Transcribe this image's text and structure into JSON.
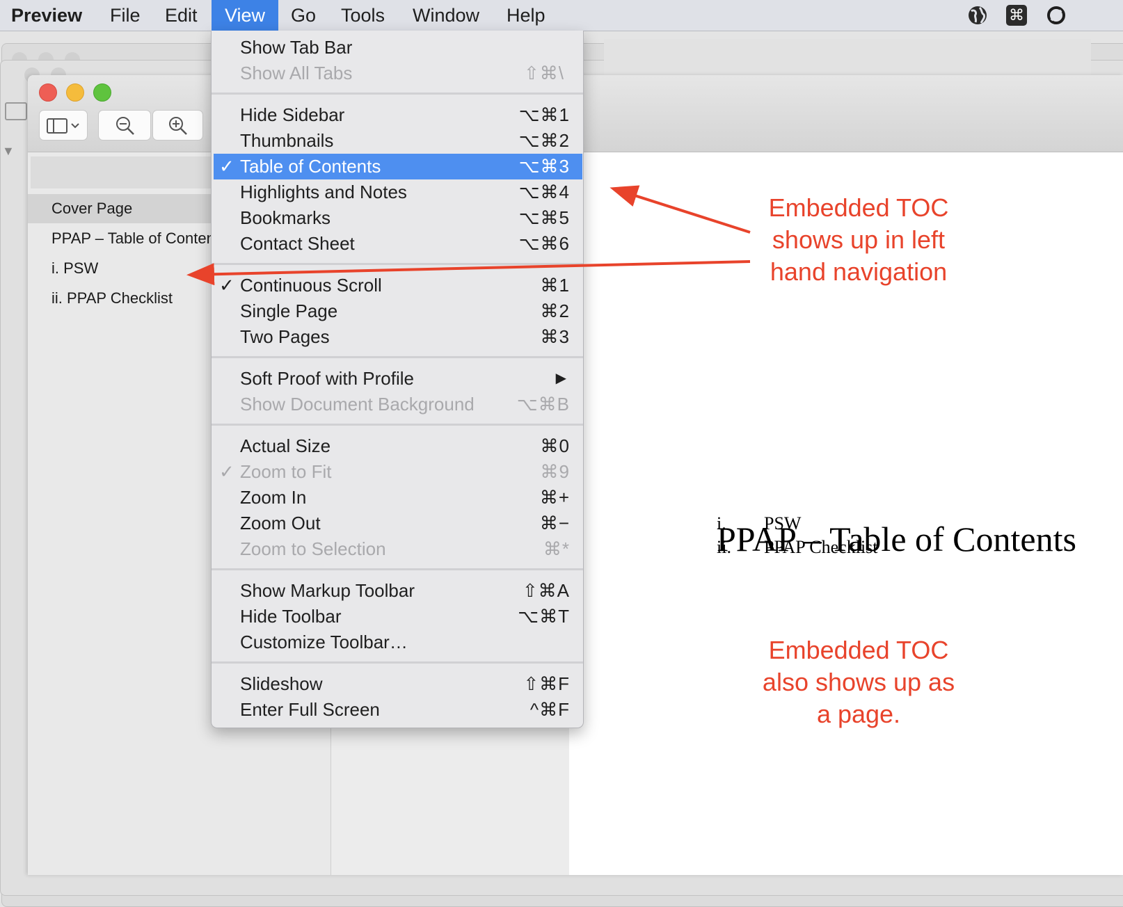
{
  "menubar": {
    "app": "Preview",
    "items": [
      "File",
      "Edit",
      "View",
      "Go",
      "Tools",
      "Window",
      "Help"
    ],
    "active": "View"
  },
  "sidebar": {
    "items": [
      "Cover Page",
      "PPAP – Table of Contents",
      "i. PSW",
      "ii. PPAP Checklist"
    ],
    "selected": "Cover Page"
  },
  "menu": {
    "show_tab_bar": {
      "label": "Show Tab Bar",
      "shortcut": ""
    },
    "show_all_tabs": {
      "label": "Show All Tabs",
      "shortcut": "⇧⌘\\"
    },
    "hide_sidebar": {
      "label": "Hide Sidebar",
      "shortcut": "⌥⌘1"
    },
    "thumbnails": {
      "label": "Thumbnails",
      "shortcut": "⌥⌘2"
    },
    "table_of_contents": {
      "label": "Table of Contents",
      "shortcut": "⌥⌘3"
    },
    "highlights_notes": {
      "label": "Highlights and Notes",
      "shortcut": "⌥⌘4"
    },
    "bookmarks": {
      "label": "Bookmarks",
      "shortcut": "⌥⌘5"
    },
    "contact_sheet": {
      "label": "Contact Sheet",
      "shortcut": "⌥⌘6"
    },
    "continuous_scroll": {
      "label": "Continuous Scroll",
      "shortcut": "⌘1"
    },
    "single_page": {
      "label": "Single Page",
      "shortcut": "⌘2"
    },
    "two_pages": {
      "label": "Two Pages",
      "shortcut": "⌘3"
    },
    "soft_proof": {
      "label": "Soft Proof with Profile",
      "shortcut": "▶"
    },
    "show_doc_bg": {
      "label": "Show Document Background",
      "shortcut": "⌥⌘B"
    },
    "actual_size": {
      "label": "Actual Size",
      "shortcut": "⌘0"
    },
    "zoom_to_fit": {
      "label": "Zoom to Fit",
      "shortcut": "⌘9"
    },
    "zoom_in": {
      "label": "Zoom In",
      "shortcut": "⌘+"
    },
    "zoom_out": {
      "label": "Zoom Out",
      "shortcut": "⌘−"
    },
    "zoom_selection": {
      "label": "Zoom to Selection",
      "shortcut": "⌘*"
    },
    "show_markup": {
      "label": "Show Markup Toolbar",
      "shortcut": "⇧⌘A"
    },
    "hide_toolbar": {
      "label": "Hide Toolbar",
      "shortcut": "⌥⌘T"
    },
    "customize_toolbar": {
      "label": "Customize Toolbar…",
      "shortcut": ""
    },
    "slideshow": {
      "label": "Slideshow",
      "shortcut": "⇧⌘F"
    },
    "full_screen": {
      "label": "Enter Full Screen",
      "shortcut": "^⌘F"
    },
    "checkmark": "✓"
  },
  "document": {
    "title": "PPAP – Table of Contents",
    "entries": [
      {
        "num": "i.",
        "text": "PSW"
      },
      {
        "num": "ii.",
        "text": "PPAP Checklist"
      }
    ]
  },
  "annotations": {
    "note1": [
      "Embedded TOC",
      "shows up in left",
      "hand navigation"
    ],
    "note2": [
      "Embedded TOC",
      "also shows up as",
      "a page."
    ],
    "color": "#e8432b"
  },
  "colors": {
    "highlight": "#4e8ff0",
    "menubar_active": "#3d82e6",
    "close": "#ee5e55",
    "minimize": "#f5bc3c",
    "zoom": "#5fc33e"
  }
}
